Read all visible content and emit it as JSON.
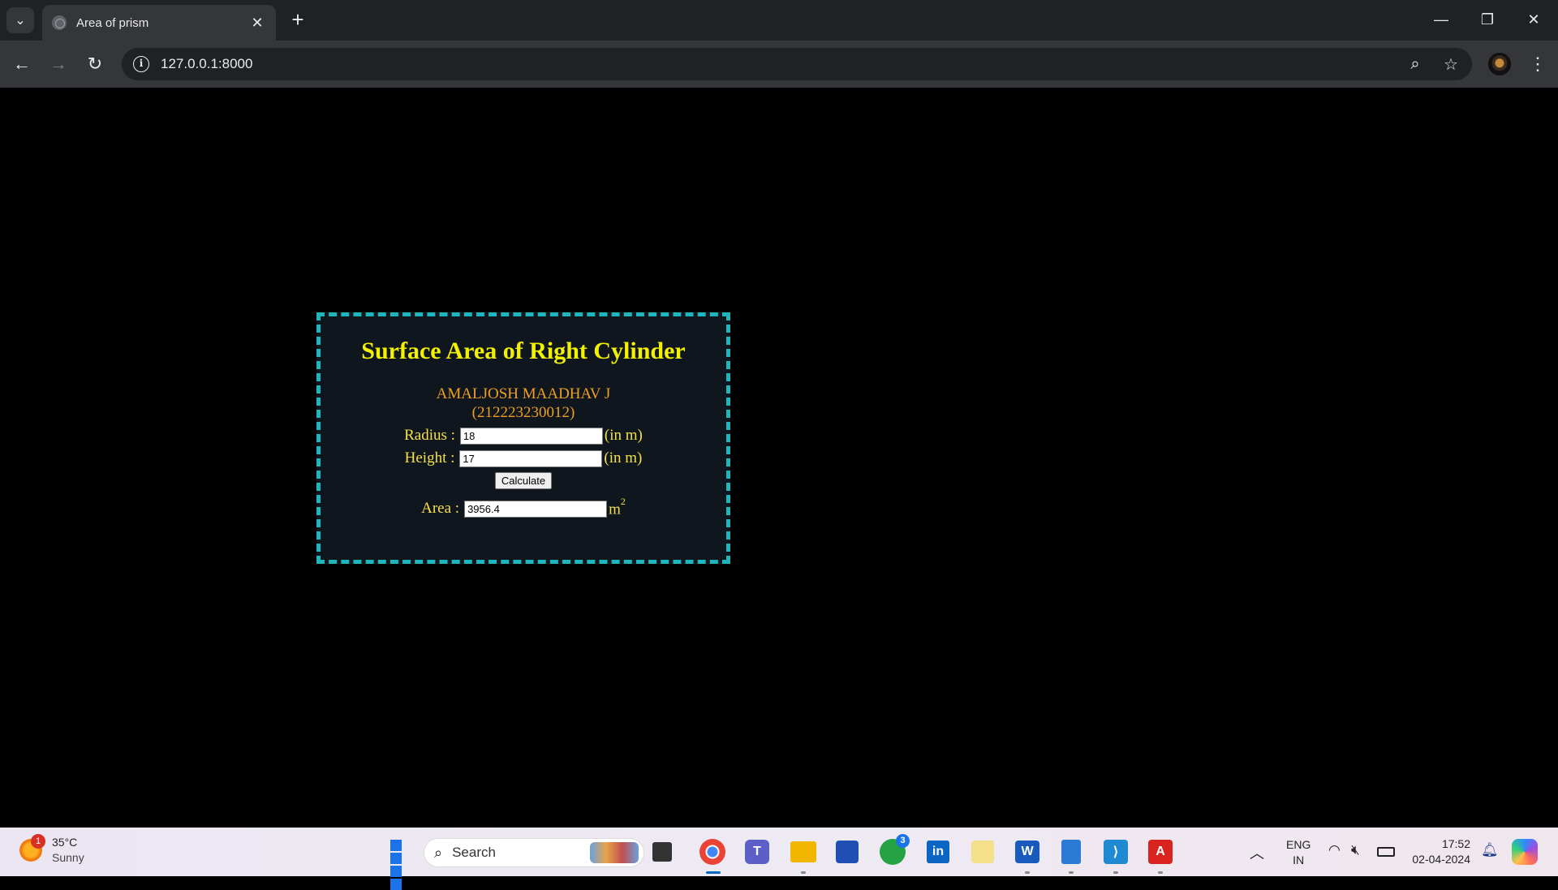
{
  "browser": {
    "tab_title": "Area of prism",
    "url": "127.0.0.1:8000"
  },
  "page": {
    "heading": "Surface Area of Right Cylinder",
    "author_name": "AMALJOSH MAADHAV J",
    "author_id": "(212223230012)",
    "radius_label": "Radius :",
    "radius_value": "18",
    "radius_unit": "(in m)",
    "height_label": "Height :",
    "height_value": "17",
    "height_unit": "(in m)",
    "calculate_label": "Calculate",
    "area_label": "Area :",
    "area_value": "3956.4",
    "area_unit_base": "m",
    "area_unit_exp": "2"
  },
  "taskbar": {
    "weather_temp": "35°C",
    "weather_cond": "Sunny",
    "weather_badge": "1",
    "search_placeholder": "Search",
    "whatsapp_badge": "3",
    "lang_top": "ENG",
    "lang_bottom": "IN",
    "time": "17:52",
    "date": "02-04-2024"
  },
  "colors": {
    "card_border": "#1fb5bd",
    "heading": "#f2f200",
    "author": "#f0a020",
    "labels": "#f6e04a"
  }
}
